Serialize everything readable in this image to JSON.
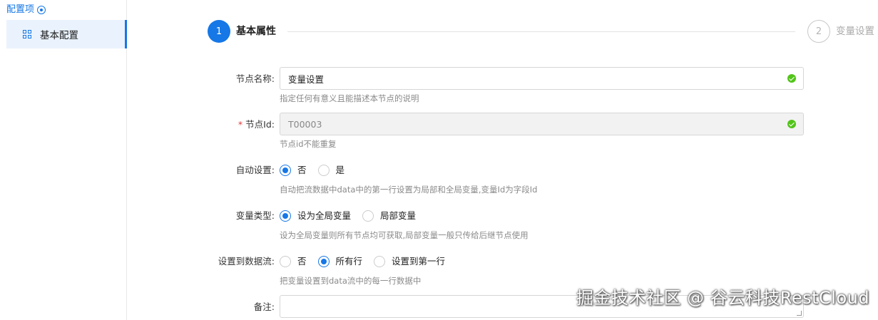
{
  "sidebar": {
    "title": "配置项",
    "title_icon": "settings-circle-icon",
    "items": [
      {
        "label": "基本配置",
        "icon": "grid-icon",
        "active": true
      }
    ]
  },
  "steps": [
    {
      "number": "1",
      "label": "基本属性",
      "active": true
    },
    {
      "number": "2",
      "label": "变量设置",
      "active": false
    }
  ],
  "form": {
    "node_name": {
      "label": "节点名称:",
      "value": "变量设置",
      "help": "指定任何有意义且能描述本节点的说明"
    },
    "node_id": {
      "required_mark": "*",
      "label": "节点Id:",
      "value": "T00003",
      "help": "节点id不能重复"
    },
    "auto_set": {
      "label": "自动设置:",
      "options": [
        "否",
        "是"
      ],
      "selected": "否",
      "help": "自动把流数据中data中的第一行设置为局部和全局变量,变量Id为字段Id"
    },
    "var_type": {
      "label": "变量类型:",
      "options": [
        "设为全局变量",
        "局部变量"
      ],
      "selected": "设为全局变量",
      "help": "设为全局变量则所有节点均可获取,局部变量一般只传给后继节点使用"
    },
    "set_to_stream": {
      "label": "设置到数据流:",
      "options": [
        "否",
        "所有行",
        "设置到第一行"
      ],
      "selected": "所有行",
      "help": "把变量设置到data流中的每一行数据中"
    },
    "remark": {
      "label": "备注:",
      "value": ""
    }
  },
  "watermark": "掘金技术社区 @ 谷云科技RestCloud",
  "colors": {
    "accent": "#1677e6",
    "success": "#52c41a",
    "required": "#e23b3b"
  }
}
